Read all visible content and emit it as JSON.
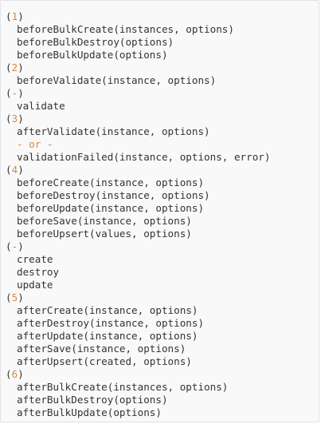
{
  "colors": {
    "background": "#f9f9f9",
    "border": "#e1e1e8",
    "text": "#333333",
    "number_accent": "#d98a3c"
  },
  "code": {
    "lines": [
      {
        "type": "step",
        "num": "1"
      },
      {
        "type": "hook",
        "text": "beforeBulkCreate(instances, options)"
      },
      {
        "type": "hook",
        "text": "beforeBulkDestroy(options)"
      },
      {
        "type": "hook",
        "text": "beforeBulkUpdate(options)"
      },
      {
        "type": "step",
        "num": "2"
      },
      {
        "type": "hook",
        "text": "beforeValidate(instance, options)"
      },
      {
        "type": "step",
        "num": "-"
      },
      {
        "type": "hook",
        "text": "validate"
      },
      {
        "type": "step",
        "num": "3"
      },
      {
        "type": "hook",
        "text": "afterValidate(instance, options)"
      },
      {
        "type": "or",
        "text": "- or -"
      },
      {
        "type": "hook",
        "text": "validationFailed(instance, options, error)"
      },
      {
        "type": "step",
        "num": "4"
      },
      {
        "type": "hook",
        "text": "beforeCreate(instance, options)"
      },
      {
        "type": "hook",
        "text": "beforeDestroy(instance, options)"
      },
      {
        "type": "hook",
        "text": "beforeUpdate(instance, options)"
      },
      {
        "type": "hook",
        "text": "beforeSave(instance, options)"
      },
      {
        "type": "hook",
        "text": "beforeUpsert(values, options)"
      },
      {
        "type": "step",
        "num": "-"
      },
      {
        "type": "hook",
        "text": "create"
      },
      {
        "type": "hook",
        "text": "destroy"
      },
      {
        "type": "hook",
        "text": "update"
      },
      {
        "type": "step",
        "num": "5"
      },
      {
        "type": "hook",
        "text": "afterCreate(instance, options)"
      },
      {
        "type": "hook",
        "text": "afterDestroy(instance, options)"
      },
      {
        "type": "hook",
        "text": "afterUpdate(instance, options)"
      },
      {
        "type": "hook",
        "text": "afterSave(instance, options)"
      },
      {
        "type": "hook",
        "text": "afterUpsert(created, options)"
      },
      {
        "type": "step",
        "num": "6"
      },
      {
        "type": "hook",
        "text": "afterBulkCreate(instances, options)"
      },
      {
        "type": "hook",
        "text": "afterBulkDestroy(options)"
      },
      {
        "type": "hook",
        "text": "afterBulkUpdate(options)"
      }
    ]
  }
}
